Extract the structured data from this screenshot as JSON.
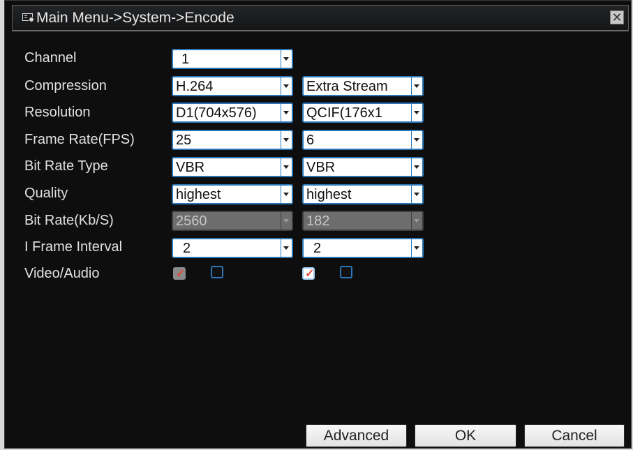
{
  "window": {
    "title": "Main Menu->System->Encode",
    "title_icon": "video-settings-icon",
    "close_label": "✕"
  },
  "form": {
    "labels": {
      "channel": "Channel",
      "compression": "Compression",
      "resolution": "Resolution",
      "frame_rate": "Frame Rate(FPS)",
      "bit_rate_type": "Bit Rate Type",
      "quality": "Quality",
      "bit_rate": "Bit Rate(Kb/S)",
      "i_frame_interval": "I Frame Interval",
      "video_audio": "Video/Audio"
    },
    "main_stream": {
      "channel": "1",
      "compression": "H.264",
      "resolution": "D1(704x576)",
      "frame_rate": "25",
      "bit_rate_type": "VBR",
      "quality": "highest",
      "bit_rate": "2560",
      "i_frame_interval": "2",
      "video_checked": true,
      "video_disabled": true,
      "audio_checked": false
    },
    "extra_stream": {
      "stream_type": "Extra Stream",
      "resolution": "QCIF(176x1",
      "frame_rate": "6",
      "bit_rate_type": "VBR",
      "quality": "highest",
      "bit_rate": "182",
      "i_frame_interval": "2",
      "video_checked": true,
      "audio_checked": false
    }
  },
  "buttons": {
    "advanced": "Advanced",
    "ok": "OK",
    "cancel": "Cancel"
  },
  "colors": {
    "accent_border": "#2d78b8",
    "dialog_background": "#0e0e0f",
    "check_mark": "#e04a3a"
  }
}
